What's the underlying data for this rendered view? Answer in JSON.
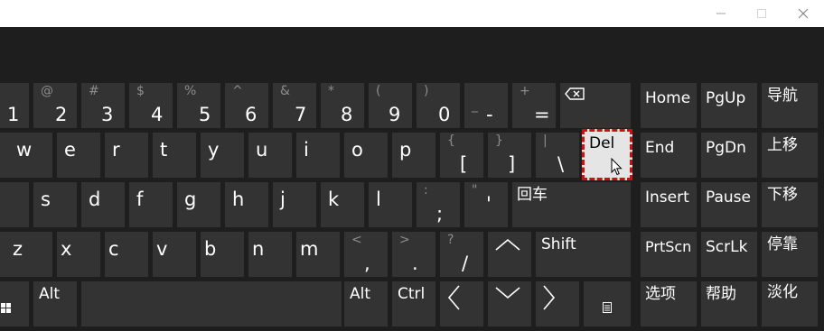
{
  "window": {
    "minimize_icon": "minimize-icon",
    "maximize_icon": "maximize-icon",
    "close_icon": "close-icon"
  },
  "keys": {
    "row1": [
      {
        "main": "1",
        "shift": ""
      },
      {
        "main": "2",
        "shift": "@"
      },
      {
        "main": "3",
        "shift": "#"
      },
      {
        "main": "4",
        "shift": "$"
      },
      {
        "main": "5",
        "shift": "%"
      },
      {
        "main": "6",
        "shift": "^"
      },
      {
        "main": "7",
        "shift": "&"
      },
      {
        "main": "8",
        "shift": "*"
      },
      {
        "main": "9",
        "shift": "("
      },
      {
        "main": "0",
        "shift": ")"
      },
      {
        "main": "-",
        "shift": "_"
      },
      {
        "main": "=",
        "shift": "+"
      }
    ],
    "row2": [
      {
        "main": "w",
        "shift": ""
      },
      {
        "main": "e",
        "shift": ""
      },
      {
        "main": "r",
        "shift": ""
      },
      {
        "main": "t",
        "shift": ""
      },
      {
        "main": "y",
        "shift": ""
      },
      {
        "main": "u",
        "shift": ""
      },
      {
        "main": "i",
        "shift": ""
      },
      {
        "main": "o",
        "shift": ""
      },
      {
        "main": "p",
        "shift": ""
      },
      {
        "main": "[",
        "shift": "{"
      },
      {
        "main": "]",
        "shift": "}"
      },
      {
        "main": "\\",
        "shift": "|"
      }
    ],
    "row3": [
      {
        "main": "s",
        "shift": ""
      },
      {
        "main": "d",
        "shift": ""
      },
      {
        "main": "f",
        "shift": ""
      },
      {
        "main": "g",
        "shift": ""
      },
      {
        "main": "h",
        "shift": ""
      },
      {
        "main": "j",
        "shift": ""
      },
      {
        "main": "k",
        "shift": ""
      },
      {
        "main": "l",
        "shift": ""
      },
      {
        "main": ";",
        "shift": ":"
      },
      {
        "main": "'",
        "shift": "\""
      }
    ],
    "row4": [
      {
        "main": "z",
        "shift": ""
      },
      {
        "main": "x",
        "shift": ""
      },
      {
        "main": "c",
        "shift": ""
      },
      {
        "main": "v",
        "shift": ""
      },
      {
        "main": "b",
        "shift": ""
      },
      {
        "main": "n",
        "shift": ""
      },
      {
        "main": "m",
        "shift": ""
      },
      {
        "main": ",",
        "shift": "<"
      },
      {
        "main": ".",
        "shift": ">"
      },
      {
        "main": "/",
        "shift": "?"
      }
    ],
    "del": "Del",
    "enter": "回车",
    "shift": "Shift",
    "alt_left": "Alt",
    "alt_right": "Alt",
    "ctrl": "Ctrl"
  },
  "nav": {
    "home": "Home",
    "pgup": "PgUp",
    "navigate": "导航",
    "end": "End",
    "pgdn": "PgDn",
    "move_up": "上移",
    "insert": "Insert",
    "pause": "Pause",
    "move_down": "下移",
    "prtscn": "PrtScn",
    "scrlk": "ScrLk",
    "dock": "停靠",
    "options": "选项",
    "help": "帮助",
    "fade": "淡化"
  }
}
